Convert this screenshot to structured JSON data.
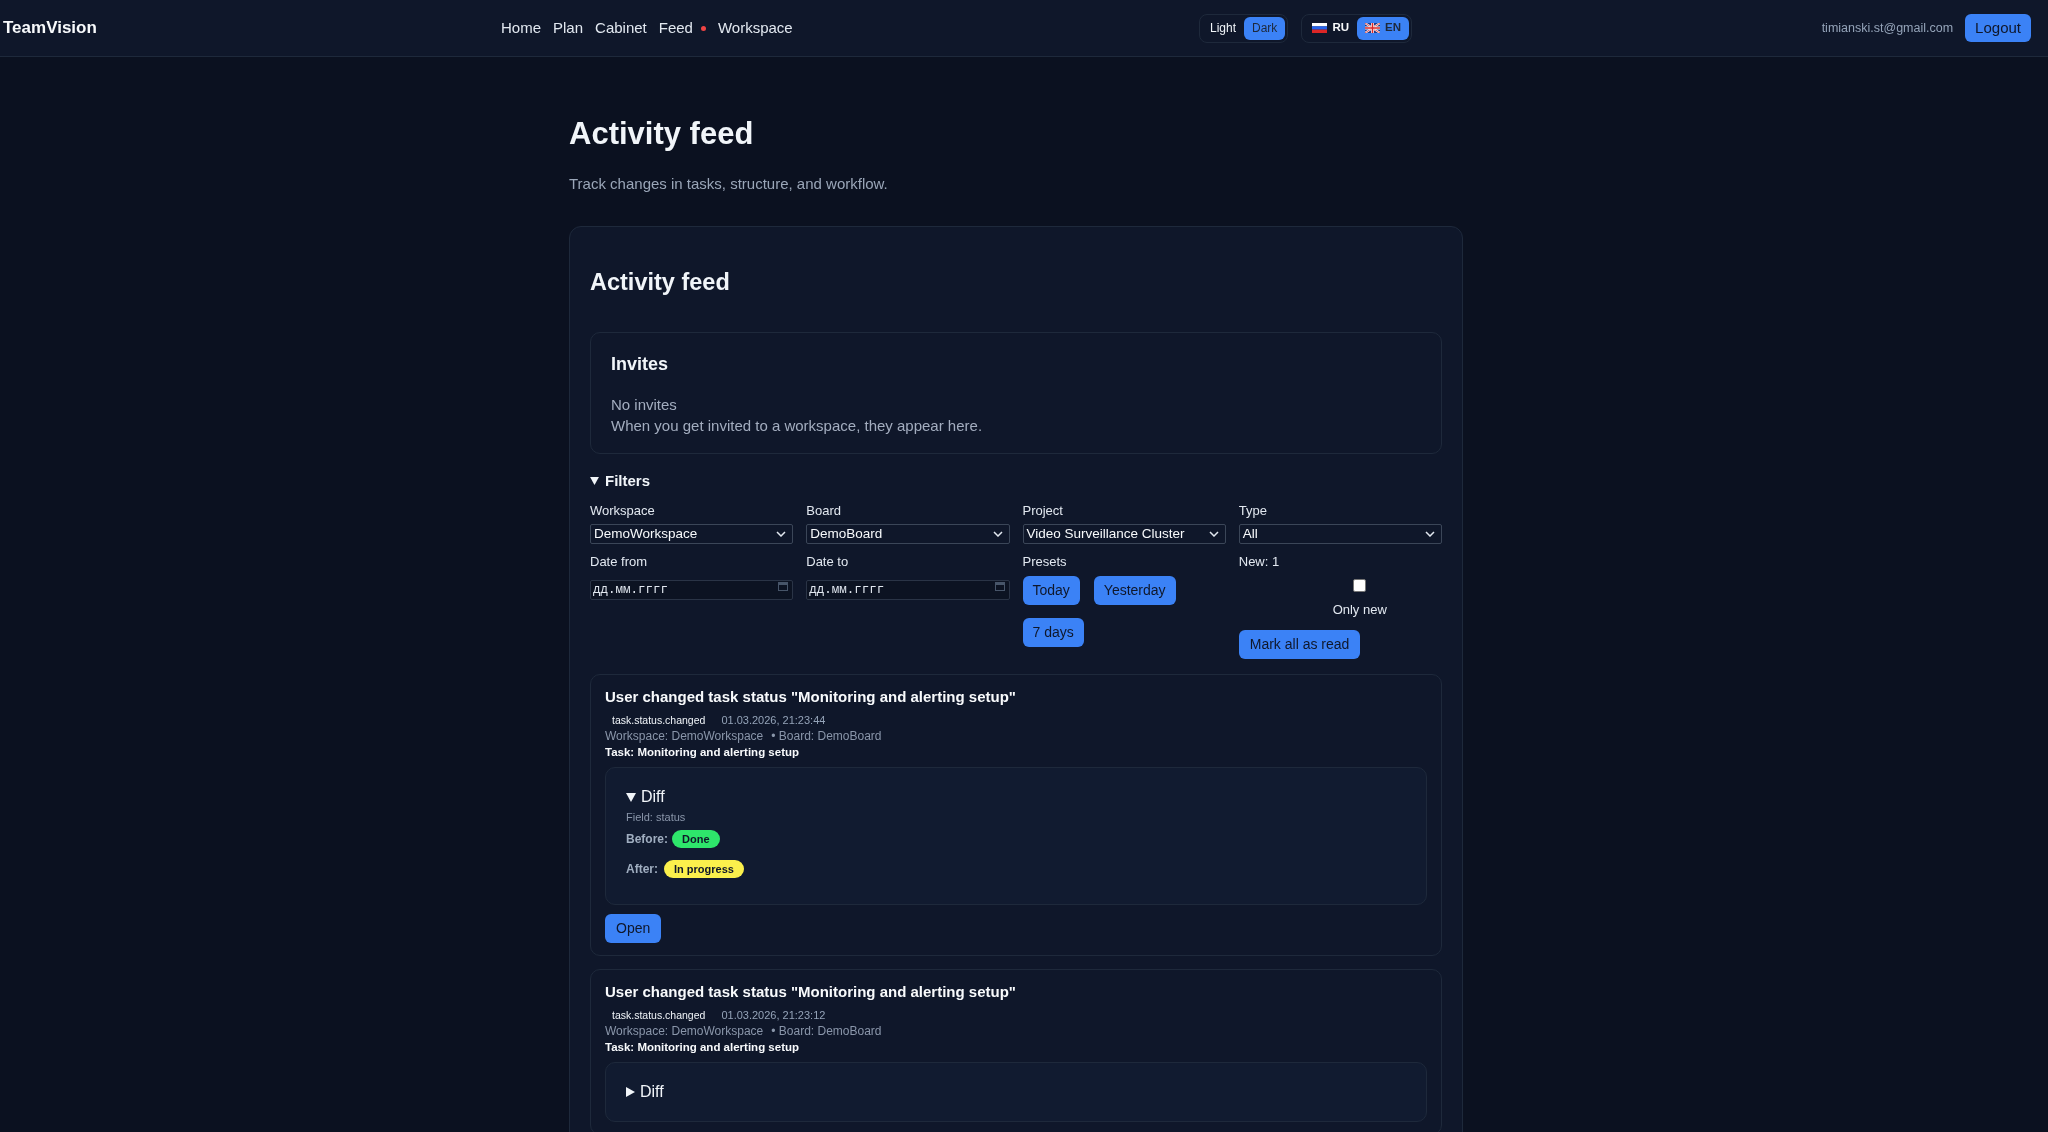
{
  "header": {
    "logo": "TeamVision",
    "nav": [
      {
        "label": "Home",
        "notification": false
      },
      {
        "label": "Plan",
        "notification": false
      },
      {
        "label": "Cabinet",
        "notification": false
      },
      {
        "label": "Feed",
        "notification": true
      },
      {
        "label": "Workspace",
        "notification": false
      }
    ],
    "theme_toggle": [
      {
        "label": "Light",
        "selected": false
      },
      {
        "label": "Dark",
        "selected": true
      }
    ],
    "language_toggle": [
      {
        "label": "RU",
        "selected": false
      },
      {
        "label": "EN",
        "selected": true
      }
    ],
    "user_email": "timianski.st@gmail.com",
    "logout_button": "Logout"
  },
  "page": {
    "title": "Activity feed",
    "subtitle": "Track changes in tasks, structure, and workflow."
  },
  "card": {
    "title": "Activity feed",
    "invites": {
      "title": "Invites",
      "empty_title": "No invites",
      "empty_text": "When you get invited to a workspace, they appear here."
    },
    "filters": {
      "label": "Filters",
      "expanded": true,
      "selects": [
        {
          "label": "Workspace",
          "value": "DemoWorkspace"
        },
        {
          "label": "Board",
          "value": "DemoBoard"
        },
        {
          "label": "Project",
          "value": "Video Surveillance Cluster"
        },
        {
          "label": "Type",
          "value": "All"
        }
      ],
      "dates": [
        {
          "label": "Date from",
          "placeholder": "дд.мм.гггг"
        },
        {
          "label": "Date to",
          "placeholder": "дд.мм.гггг"
        }
      ],
      "presets": {
        "label": "Presets",
        "buttons": [
          "Today",
          "Yesterday",
          "7 days"
        ]
      },
      "new_count": "New: 1",
      "only_new": {
        "label": "Only new",
        "checked": false
      },
      "mark_all_button": "Mark all as read"
    },
    "events": [
      {
        "title": "User changed task status \"Monitoring and alerting setup\"",
        "type": "task.status.changed",
        "time": "01.03.2026, 21:23:44",
        "workspace": "Workspace: DemoWorkspace",
        "board": "• Board: DemoBoard",
        "task": "Task: Monitoring and alerting setup",
        "diff": {
          "label": "Diff",
          "expanded": true,
          "field": "Field: status",
          "changes": [
            {
              "label": "Before:",
              "value": "Done",
              "color": "#2ee66b"
            },
            {
              "label": "After:",
              "value": "In progress",
              "color": "#fbf04c"
            }
          ]
        },
        "open_button": "Open"
      },
      {
        "title": "User changed task status \"Monitoring and alerting setup\"",
        "type": "task.status.changed",
        "time": "01.03.2026, 21:23:12",
        "workspace": "Workspace: DemoWorkspace",
        "board": "• Board: DemoBoard",
        "task": "Task: Monitoring and alerting setup",
        "diff": {
          "label": "Diff",
          "expanded": false
        }
      }
    ]
  }
}
